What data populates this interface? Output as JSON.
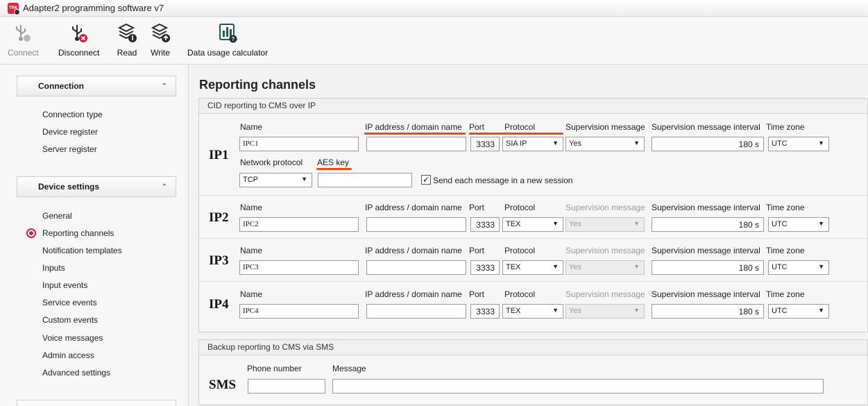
{
  "window": {
    "title": "Adapter2 programming software v7"
  },
  "toolbar": {
    "connect": "Connect",
    "disconnect": "Disconnect",
    "read": "Read",
    "write": "Write",
    "data_usage": "Data usage calculator"
  },
  "sidebar": {
    "connection_header": "Connection",
    "connection_items": [
      "Connection type",
      "Device register",
      "Server register"
    ],
    "device_header": "Device settings",
    "device_items": [
      "General",
      "Reporting channels",
      "Notification templates",
      "Inputs",
      "Input events",
      "Service events",
      "Custom events",
      "Voice messages",
      "Admin access",
      "Advanced settings"
    ],
    "selected": "Reporting channels"
  },
  "main": {
    "title": "Reporting channels",
    "cid_group": "CID reporting to CMS over IP",
    "labels": {
      "name": "Name",
      "ip": "IP address / domain name",
      "port": "Port",
      "protocol": "Protocol",
      "supervision": "Supervision message",
      "supervision_interval": "Supervision message interval",
      "timezone": "Time zone",
      "network_protocol": "Network protocol",
      "aes_key": "AES key",
      "send_new_session": "Send each message in a new session"
    },
    "channels": [
      {
        "id": "IP1",
        "name": "IPC1",
        "ip": "",
        "port": "3333",
        "protocol": "SIA IP",
        "supervision": "Yes",
        "interval": "180 s",
        "timezone": "UTC",
        "network_protocol": "TCP",
        "aes_key": ""
      },
      {
        "id": "IP2",
        "name": "IPC2",
        "ip": "",
        "port": "3333",
        "protocol": "TEX",
        "supervision": "Yes",
        "interval": "180 s",
        "timezone": "UTC"
      },
      {
        "id": "IP3",
        "name": "IPC3",
        "ip": "",
        "port": "3333",
        "protocol": "TEX",
        "supervision": "Yes",
        "interval": "180 s",
        "timezone": "UTC"
      },
      {
        "id": "IP4",
        "name": "IPC4",
        "ip": "",
        "port": "3333",
        "protocol": "TEX",
        "supervision": "Yes",
        "interval": "180 s",
        "timezone": "UTC"
      }
    ],
    "sms_group": "Backup reporting to CMS via SMS",
    "sms": {
      "id": "SMS",
      "phone_label": "Phone number",
      "message_label": "Message",
      "phone": "",
      "message": ""
    }
  },
  "colors": {
    "accent": "#d0213b",
    "annotation": "#e0501a"
  }
}
